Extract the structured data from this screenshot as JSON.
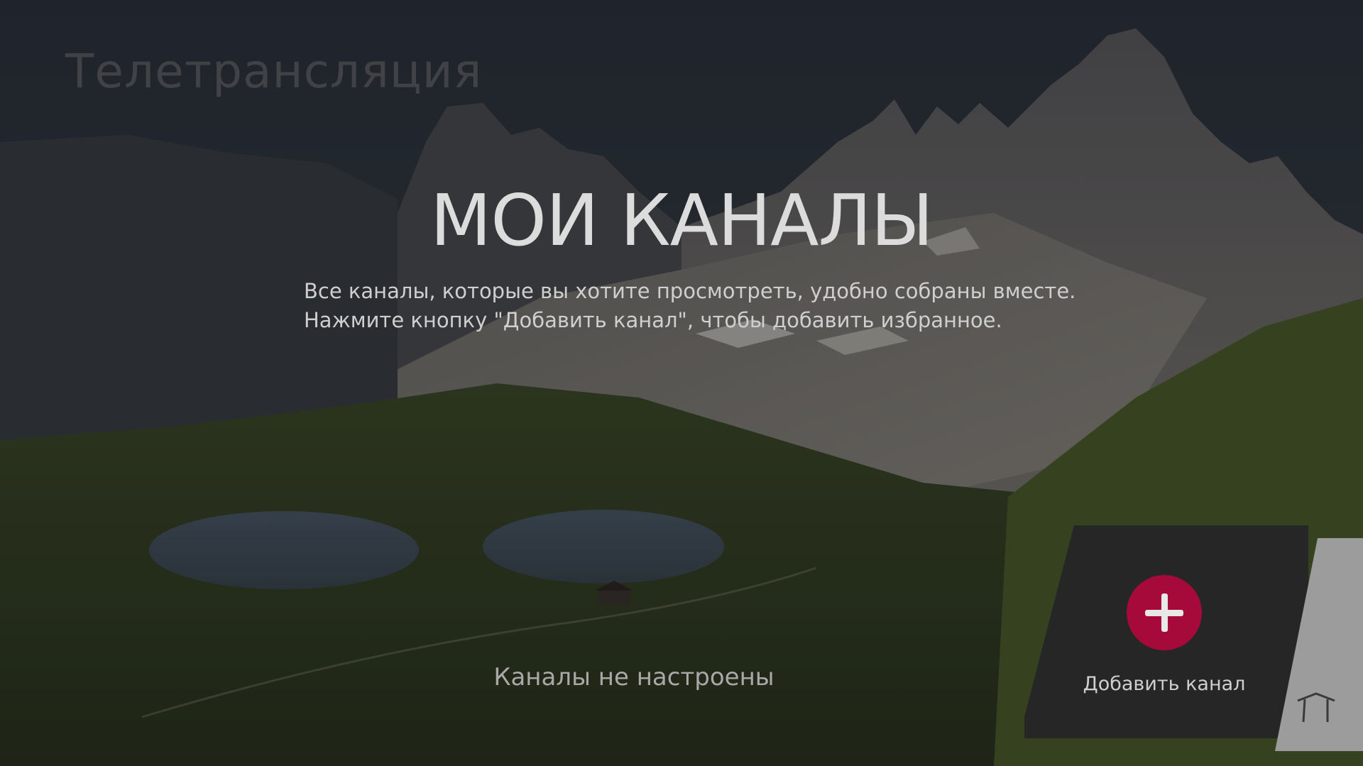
{
  "app_title": "Телетрансляция",
  "headline": "МОИ КАНАЛЫ",
  "description": {
    "line1": "Все каналы, которые вы хотите просмотреть, удобно собраны вместе.",
    "line2": "Нажмите кнопку \"Добавить канал\", чтобы добавить избранное."
  },
  "empty_message": "Каналы не настроены",
  "add_card": {
    "label": "Добавить канал",
    "icon": "plus-icon",
    "accent_color": "#a50a3b"
  },
  "home_panel": {
    "icon": "home-icon"
  }
}
